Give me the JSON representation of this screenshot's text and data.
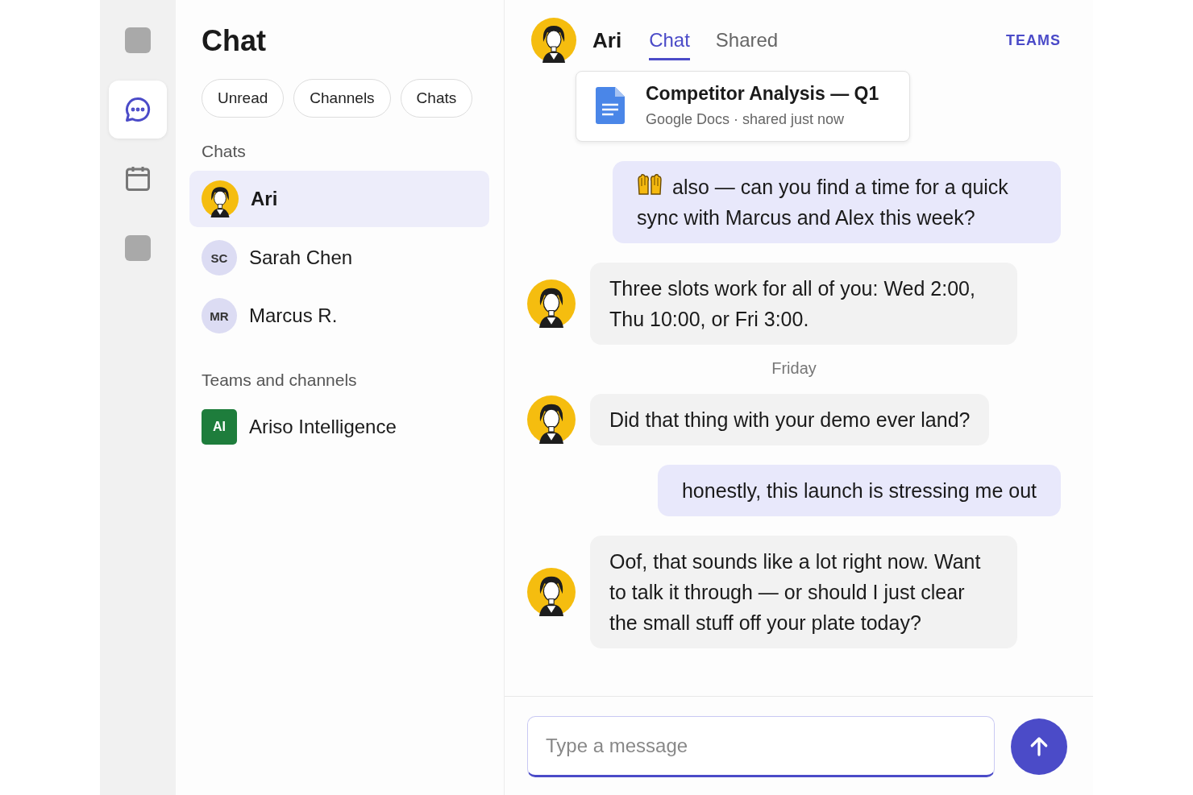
{
  "rail": [
    {
      "kind": "blank",
      "selected": false
    },
    {
      "kind": "chat",
      "selected": true
    },
    {
      "kind": "calendar",
      "selected": false
    },
    {
      "kind": "blank",
      "selected": false
    }
  ],
  "list_panel": {
    "title": "Chat",
    "filters": [
      {
        "label": "Unread",
        "selected": false
      },
      {
        "label": "Channels",
        "selected": false
      },
      {
        "label": "Chats",
        "selected": false
      }
    ],
    "sections": [
      {
        "heading": "Chats",
        "items": [
          {
            "name": "Ari",
            "selected": true
          },
          {
            "name": "Sarah Chen",
            "avatar": {
              "kind": "initials",
              "text": "SC"
            },
            "selected": false
          },
          {
            "name": "Marcus R.",
            "avatar": {
              "kind": "initials",
              "text": "MR"
            },
            "selected": false
          }
        ]
      },
      {
        "heading": "Teams and channels",
        "items": [
          {
            "name": "Ariso Intelligence",
            "avatar": {
              "kind": "team",
              "text": "AI",
              "color": "#1e7d3c"
            },
            "selected": false
          }
        ]
      }
    ]
  },
  "conversation": {
    "header": {
      "name": "Ari",
      "tabs": [
        {
          "label": "Chat",
          "selected": true
        },
        {
          "label": "Shared",
          "selected": false
        }
      ],
      "link": "TEAMS"
    },
    "messages": [
      {
        "kind": "file",
        "title": "Competitor Analysis — Q1",
        "meta": "Google Docs · shared just now"
      },
      {
        "kind": "outgoing",
        "emoji": true,
        "text": "also — can you find a time for a quick sync with Marcus and Alex this week?"
      },
      {
        "kind": "incoming",
        "text": "Three slots work for all of you: Wed 2:00, Thu 10:00, or Fri 3:00."
      },
      {
        "kind": "date",
        "text": "Friday"
      },
      {
        "kind": "incoming",
        "text": "Did that thing with your demo ever land?"
      },
      {
        "kind": "outgoing",
        "emoji": false,
        "text": "honestly, this launch is stressing me out"
      },
      {
        "kind": "incoming",
        "text": "Oof, that sounds like a lot right now. Want to talk it through — or should I just clear the small stuff off your plate today?"
      }
    ],
    "composer": {
      "placeholder": "Type a message"
    }
  }
}
